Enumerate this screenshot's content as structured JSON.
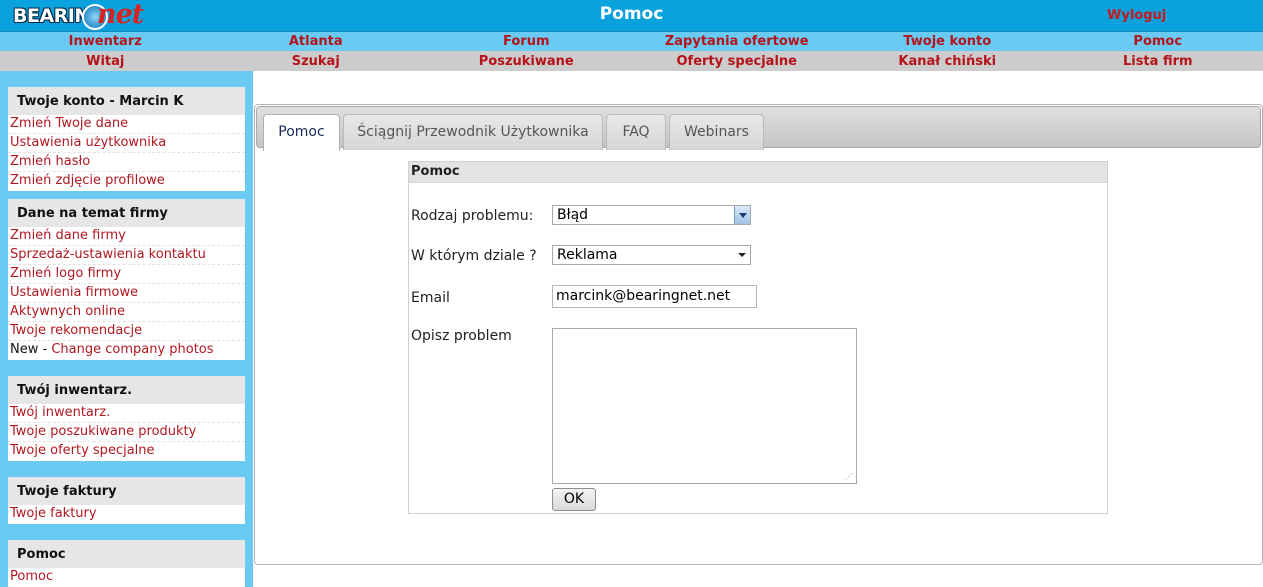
{
  "app": {
    "logo_main": "BEARING",
    "logo_accent": "net",
    "page_title": "Pomoc",
    "logout_label": "Wyloguj"
  },
  "nav_primary": [
    "Inwentarz",
    "Atlanta",
    "Forum",
    "Zapytania ofertowe",
    "Twoje konto",
    "Pomoc"
  ],
  "nav_secondary": [
    "Witaj",
    "Szukaj",
    "Poszukiwane",
    "Oferty specjalne",
    "Kanał chiński",
    "Lista firm"
  ],
  "sidebar": {
    "sections": [
      {
        "title": "Twoje konto - Marcin K",
        "items": [
          "Zmień Twoje dane",
          "Ustawienia użytkownika",
          "Zmień hasło",
          "Zmień zdjęcie profilowe"
        ]
      },
      {
        "title": "Dane na temat firmy",
        "items": [
          "Zmień dane firmy",
          "Sprzedaż-ustawienia kontaktu",
          "Zmień logo firmy",
          "Ustawienia firmowe",
          "Aktywnych online",
          "Twoje rekomendacje"
        ],
        "extra_prefix": "New - ",
        "extra_link": "Change company photos"
      },
      {
        "title": "Twój inwentarz.",
        "items": [
          "Twój inwentarz.",
          "Twoje poszukiwane produkty",
          "Twoje oferty specjalne"
        ]
      },
      {
        "title": "Twoje faktury",
        "items": [
          "Twoje faktury"
        ]
      },
      {
        "title": "Pomoc",
        "items": [
          "Pomoc"
        ]
      }
    ]
  },
  "tabs": [
    {
      "label": "Pomoc",
      "active": true
    },
    {
      "label": "Ściągnij Przewodnik Użytkownika",
      "active": false
    },
    {
      "label": "FAQ",
      "active": false
    },
    {
      "label": "Webinars",
      "active": false
    }
  ],
  "form": {
    "title": "Pomoc",
    "problem_type_label": "Rodzaj problemu:",
    "problem_type_value": "Błąd",
    "department_label": "W którym dziale ?",
    "department_value": "Reklama",
    "email_label": "Email",
    "email_value": "marcink@bearingnet.net",
    "description_label": "Opisz problem",
    "description_value": "",
    "submit_label": "OK"
  },
  "colors": {
    "header_blue": "#0aa2dc",
    "nav_light_blue": "#69caf2",
    "nav_gray": "#cccccc",
    "link_red": "#b6121a"
  }
}
